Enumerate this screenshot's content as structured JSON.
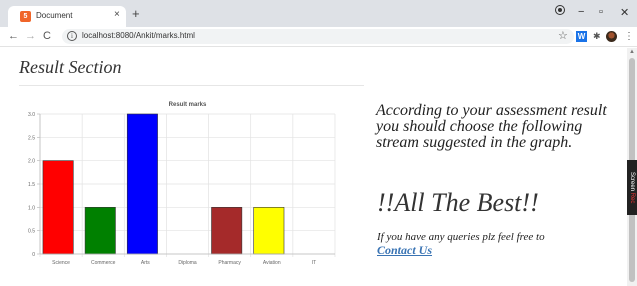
{
  "browser": {
    "tab_title": "Document",
    "tab_close": "×",
    "new_tab": "+",
    "favicon": "5",
    "url": "localhost:8080/Ankit/marks.html",
    "win_minimize": "−",
    "win_maximize": "▫",
    "win_close": "✕",
    "back": "←",
    "forward": "→",
    "reload": "C",
    "info": "i",
    "star": "☆",
    "ext_w": "W",
    "puzzle": "✱",
    "menu": "⋮",
    "side_badge_a": "Screen",
    "side_badge_b": "Rec"
  },
  "page": {
    "title": "Result Section",
    "message": "According to your assessment result you should choose the following stream suggested in the graph.",
    "best": "!!All The Best!!",
    "query": "If you have any queries plz feel free to",
    "contact": "Contact Us"
  },
  "chart_data": {
    "type": "bar",
    "title": "Result marks",
    "categories": [
      "Science",
      "Commerce",
      "Arts",
      "Diploma",
      "Pharmacy",
      "Aviation",
      "IT"
    ],
    "values": [
      2,
      1,
      3,
      0,
      1,
      1,
      0
    ],
    "colors": [
      "#ff0000",
      "#008000",
      "#0000ff",
      "#888888",
      "#a52a2a",
      "#ffff00",
      "#888888"
    ],
    "yticks": [
      "0",
      "0.5",
      "1.0",
      "1.5",
      "2.0",
      "2.5",
      "3.0"
    ],
    "ylim": [
      0,
      3
    ],
    "grid": true
  }
}
